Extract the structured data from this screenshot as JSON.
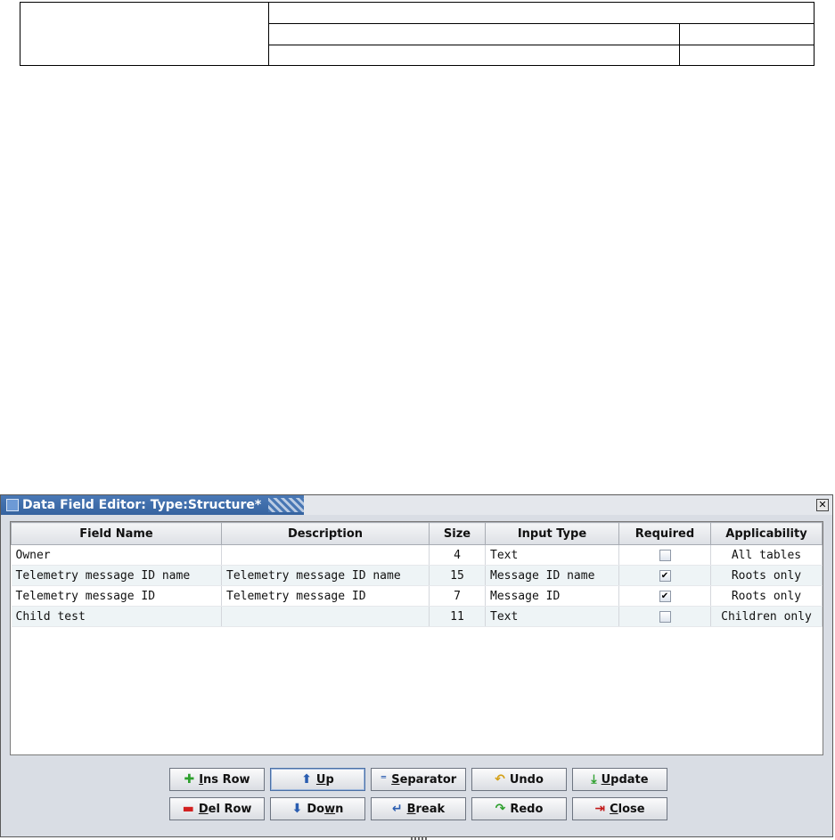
{
  "window": {
    "title": "Data Field Editor: Type:Structure*"
  },
  "table": {
    "columns": [
      "Field Name",
      "Description",
      "Size",
      "Input Type",
      "Required",
      "Applicability"
    ],
    "rows": [
      {
        "field_name": "Owner",
        "description": "",
        "size": "4",
        "input_type": "Text",
        "required": false,
        "applicability": "All tables"
      },
      {
        "field_name": "Telemetry message ID name",
        "description": "Telemetry message ID name",
        "size": "15",
        "input_type": "Message ID name",
        "required": true,
        "applicability": "Roots only"
      },
      {
        "field_name": "Telemetry message ID",
        "description": "Telemetry message ID",
        "size": "7",
        "input_type": "Message ID",
        "required": true,
        "applicability": "Roots only"
      },
      {
        "field_name": "Child test",
        "description": "",
        "size": "11",
        "input_type": "Text",
        "required": false,
        "applicability": "Children only"
      }
    ]
  },
  "buttons": {
    "ins_row": {
      "pre": "",
      "key": "I",
      "post": "ns Row",
      "icon": "plus-icon",
      "color": "#2ea02e"
    },
    "del_row": {
      "pre": "",
      "key": "D",
      "post": "el Row",
      "icon": "minus-icon",
      "color": "#d22020"
    },
    "up": {
      "pre": "",
      "key": "U",
      "post": "p",
      "icon": "arrow-up-icon",
      "color": "#2a5db0"
    },
    "down": {
      "pre": "Do",
      "key": "w",
      "post": "n",
      "icon": "arrow-down-icon",
      "color": "#2a5db0"
    },
    "separator": {
      "pre": "",
      "key": "S",
      "post": "eparator",
      "icon": "separator-icon",
      "color": "#2a5db0"
    },
    "break": {
      "pre": "",
      "key": "B",
      "post": "reak",
      "icon": "break-icon",
      "color": "#2a5db0"
    },
    "undo": {
      "pre": "Undo",
      "key": "",
      "post": "",
      "icon": "undo-icon",
      "color": "#d4a017"
    },
    "redo": {
      "pre": "Redo",
      "key": "",
      "post": "",
      "icon": "redo-icon",
      "color": "#2ea02e"
    },
    "update": {
      "pre": "",
      "key": "U",
      "post": "pdate",
      "icon": "update-icon",
      "color": "#2ea02e"
    },
    "close": {
      "pre": "",
      "key": "C",
      "post": "lose",
      "icon": "close-door-icon",
      "color": "#c21818"
    }
  },
  "icons": {
    "plus": "✚",
    "minus": "▬",
    "up": "⬆",
    "down": "⬇",
    "separator": "⁼",
    "break": "↵",
    "undo": "↶",
    "redo": "↷",
    "update": "⤓",
    "close": "⇥",
    "check": "✔",
    "window_close": "✕"
  }
}
